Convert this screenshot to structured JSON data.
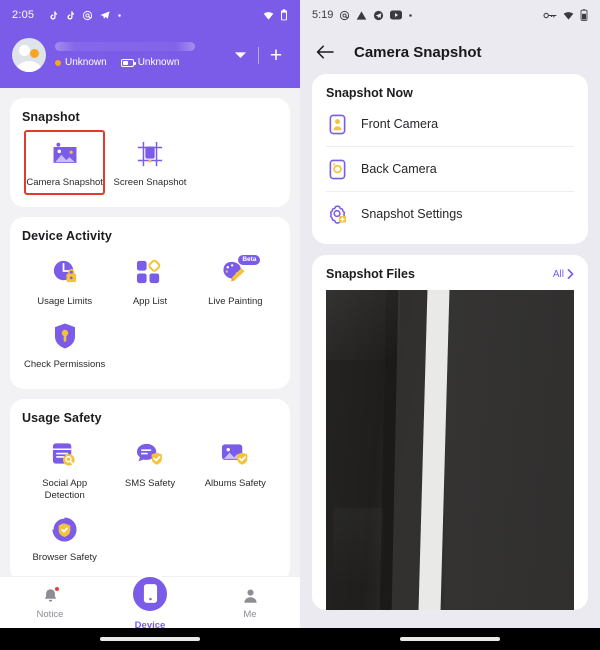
{
  "left_phone": {
    "status_bar": {
      "time": "2:05",
      "left_icons": [
        "tiktok-icon",
        "tiktok-icon",
        "at-icon",
        "telegram-icon",
        "more-dot-icon"
      ],
      "right_icons": [
        "wifi-icon",
        "battery-icon"
      ]
    },
    "account_header": {
      "device_name": "",
      "status_label": "Unknown",
      "battery_label": "Unknown",
      "chevron_label": "chevron-down-icon",
      "add_label": "+"
    },
    "sections": [
      {
        "title": "Snapshot",
        "tiles": [
          {
            "label": "Camera Snapshot",
            "icon": "camera-snapshot-icon",
            "selected": true
          },
          {
            "label": "Screen Snapshot",
            "icon": "screen-snapshot-icon",
            "selected": false
          }
        ]
      },
      {
        "title": "Device Activity",
        "tiles": [
          {
            "label": "Usage Limits",
            "icon": "usage-limits-icon",
            "selected": false
          },
          {
            "label": "App List",
            "icon": "app-list-icon",
            "selected": false
          },
          {
            "label": "Live Painting",
            "icon": "live-painting-icon",
            "selected": false,
            "badge": "Beta"
          },
          {
            "label": "Check Permissions",
            "icon": "check-permissions-icon",
            "selected": false
          }
        ]
      },
      {
        "title": "Usage Safety",
        "tiles": [
          {
            "label": "Social App Detection",
            "icon": "social-app-detection-icon",
            "selected": false
          },
          {
            "label": "SMS Safety",
            "icon": "sms-safety-icon",
            "selected": false
          },
          {
            "label": "Albums Safety",
            "icon": "albums-safety-icon",
            "selected": false
          },
          {
            "label": "Browser Safety",
            "icon": "browser-safety-icon",
            "selected": false
          }
        ]
      }
    ],
    "bottom_nav": [
      {
        "label": "Notice",
        "icon": "bell-icon",
        "active": false,
        "badge": true
      },
      {
        "label": "Device",
        "icon": "phone-icon",
        "active": true,
        "badge": false
      },
      {
        "label": "Me",
        "icon": "person-icon",
        "active": false,
        "badge": false
      }
    ]
  },
  "right_phone": {
    "status_bar": {
      "time": "5:19",
      "left_icons": [
        "at-icon",
        "warning-icon",
        "telegram-icon",
        "youtube-icon",
        "more-dot-icon"
      ],
      "right_icons": [
        "vpn-key-icon",
        "wifi-icon",
        "battery-icon"
      ]
    },
    "app_bar": {
      "back_icon": "back-arrow-icon",
      "title": "Camera Snapshot"
    },
    "snapshot_now": {
      "title": "Snapshot Now",
      "rows": [
        {
          "label": "Front Camera",
          "icon": "front-camera-icon"
        },
        {
          "label": "Back Camera",
          "icon": "back-camera-icon"
        },
        {
          "label": "Snapshot Settings",
          "icon": "snapshot-settings-icon"
        }
      ]
    },
    "snapshot_files": {
      "title": "Snapshot Files",
      "all_label": "All",
      "all_chevron": "chevron-right-icon",
      "preview_alt": "dark-photo-preview"
    }
  },
  "colors": {
    "brand_purple": "#7b5ce8",
    "accent_yellow": "#f5c33b",
    "selection_red": "#e03b2f",
    "page_bg": "#f2f2f5",
    "right_bg": "#eceaf1"
  }
}
